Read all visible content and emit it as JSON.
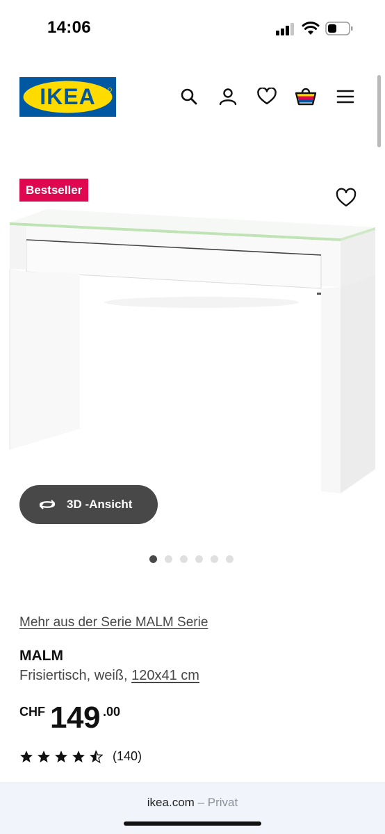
{
  "status_bar": {
    "time": "14:06"
  },
  "header": {
    "logo_text": "IKEA",
    "icons": [
      "search-icon",
      "account-icon",
      "heart-icon",
      "basket-icon",
      "menu-icon"
    ]
  },
  "product": {
    "badge": "Bestseller",
    "view_3d_label": "3D -Ansicht",
    "carousel": {
      "count": 6,
      "active": 1
    },
    "series_link": "Mehr aus der Serie MALM Serie",
    "name": "MALM",
    "description": "Frisiertisch, weiß, ",
    "size": "120x41 cm",
    "price": {
      "currency": "CHF",
      "integer": "149",
      "decimal": ".00"
    },
    "rating": {
      "stars": 4.5,
      "count": "(140)"
    }
  },
  "browser": {
    "domain": "ikea.com",
    "separator": "–",
    "mode": "Privat"
  },
  "colors": {
    "accent_badge": "#e00751",
    "ikea_blue": "#0058a3",
    "ikea_yellow": "#ffdb00",
    "button_dark": "#484848"
  }
}
